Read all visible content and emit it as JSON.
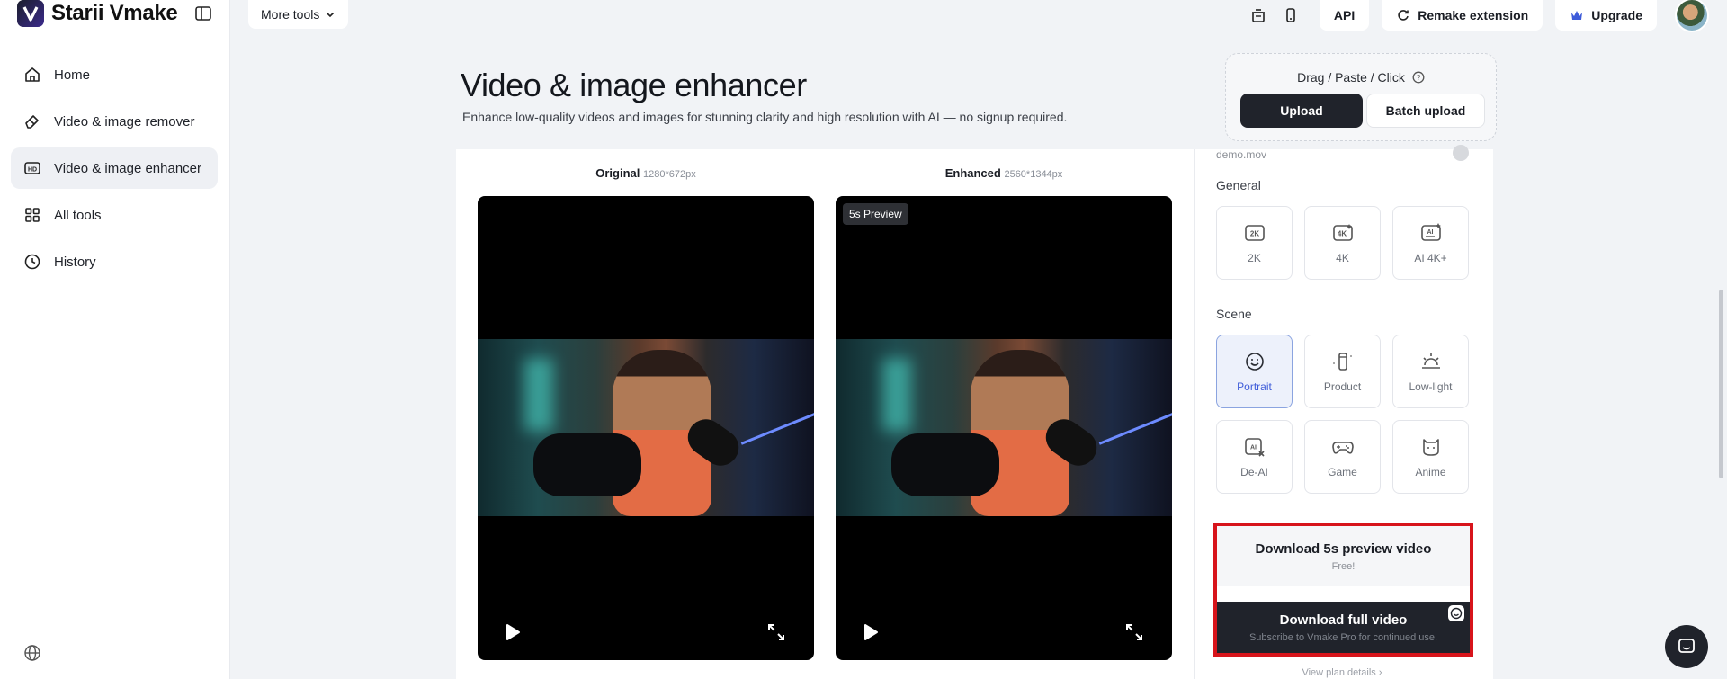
{
  "app": {
    "name": "Starii Vmake"
  },
  "sidebar": {
    "items": [
      {
        "label": "Home",
        "icon": "home-icon"
      },
      {
        "label": "Video & image remover",
        "icon": "eraser-icon"
      },
      {
        "label": "Video & image enhancer",
        "icon": "hd-icon",
        "active": true
      },
      {
        "label": "All tools",
        "icon": "grid-icon"
      },
      {
        "label": "History",
        "icon": "clock-icon"
      }
    ]
  },
  "topbar": {
    "more_tools": "More tools",
    "api": "API",
    "remake_extension": "Remake extension",
    "upgrade": "Upgrade"
  },
  "page": {
    "title": "Video & image enhancer",
    "subtitle": "Enhance low-quality videos and images for stunning clarity and high resolution with AI — no signup required."
  },
  "upload": {
    "caption": "Drag / Paste / Click",
    "upload_label": "Upload",
    "batch_label": "Batch upload"
  },
  "compare": {
    "original_label": "Original",
    "original_res": "1280*672px",
    "enhanced_label": "Enhanced",
    "enhanced_res": "2560*1344px",
    "preview_badge": "5s Preview"
  },
  "panel": {
    "file_name": "demo.mov",
    "general_heading": "General",
    "general_options": [
      "2K",
      "4K",
      "AI 4K+"
    ],
    "scene_heading": "Scene",
    "scene_options": [
      "Portrait",
      "Product",
      "Low-light",
      "De-AI",
      "Game",
      "Anime"
    ],
    "selected_scene": "Portrait",
    "download_preview_label": "Download 5s preview video",
    "download_preview_sub": "Free!",
    "download_full_label": "Download full video",
    "download_full_sub": "Subscribe to Vmake Pro for continued use.",
    "plan_link": "View plan details ›"
  },
  "colors": {
    "accent_dark": "#20232b",
    "highlight_border": "#d7141b",
    "selected_bg": "#edf1fb"
  }
}
